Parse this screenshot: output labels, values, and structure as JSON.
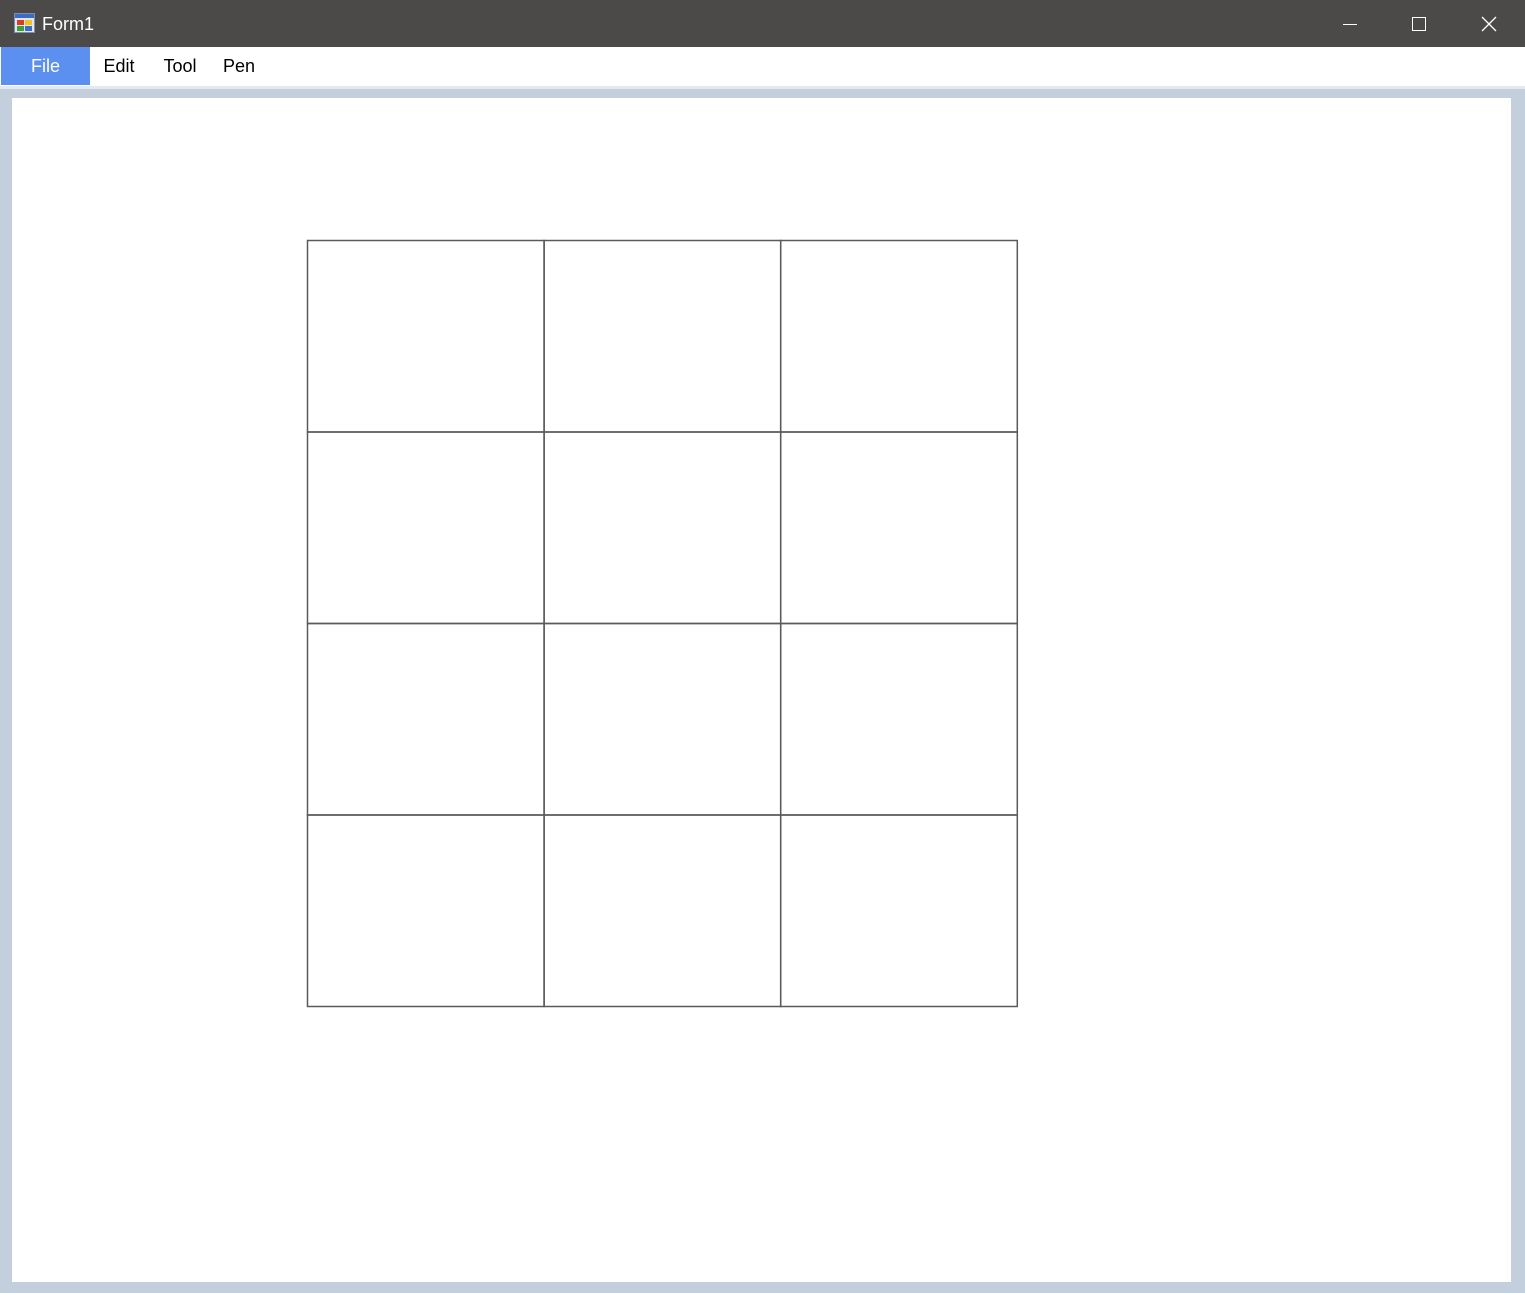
{
  "window": {
    "title": "Form1",
    "icons": {
      "app": "app-form-icon",
      "minimize": "minimize-icon",
      "maximize": "maximize-icon",
      "close": "close-icon"
    },
    "colors": {
      "titlebar": "#4b4a48",
      "frame": "#c3cfdd",
      "menu_active": "#5b8ff0",
      "grid_line": "#5a5a5a"
    }
  },
  "menu": {
    "items": [
      {
        "label": "File",
        "active": true
      },
      {
        "label": "Edit",
        "active": false
      },
      {
        "label": "Tool",
        "active": false
      },
      {
        "label": "Pen",
        "active": false
      }
    ]
  },
  "canvas": {
    "grid": {
      "rows": 4,
      "columns": 3
    }
  }
}
